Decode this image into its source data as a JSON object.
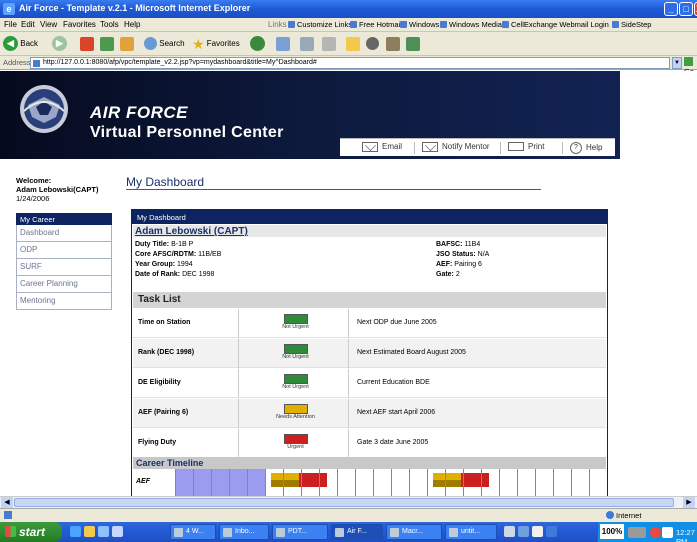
{
  "window": {
    "title": "Air Force - Template v.2.1 - Microsoft Internet Explorer",
    "min_glyph": "_",
    "max_glyph": "□",
    "close_glyph": "X"
  },
  "menu": {
    "items": [
      "File",
      "Edit",
      "View",
      "Favorites",
      "Tools",
      "Help"
    ],
    "links_label": "Links",
    "links": [
      "Customize Links",
      "Free Hotmail",
      "Windows",
      "Windows Media",
      "CellExchange Webmail Login",
      "SideStep"
    ]
  },
  "toolbar": {
    "back_label": "Back",
    "search_label": "Search",
    "favorites_label": "Favorites"
  },
  "address": {
    "label": "Address",
    "url": "http://127.0.0.1:8080/afp/vpc/template_v2.2.jsp?vp=mydashboard&title=My^Dashboard#",
    "go_label": "Go"
  },
  "banner": {
    "line1": "AIR FORCE",
    "line2": "Virtual Personnel Center"
  },
  "actions": {
    "email": "Email",
    "notify": "Notify Mentor",
    "print": "Print",
    "help": "Help"
  },
  "welcome": {
    "greeting": "Welcome:",
    "user": "Adam Lebowski(CAPT)",
    "date": "1/24/2006"
  },
  "page_title": "My Dashboard",
  "sidenav": {
    "header": "My Career",
    "items": [
      "Dashboard",
      "ODP",
      "SURF",
      "Career Planning",
      "Mentoring"
    ]
  },
  "dashboard": {
    "header": "My Dashboard",
    "name": "Adam Lebowski (CAPT)",
    "left_fields": [
      {
        "label": "Duty Title:",
        "value": "B-1B P"
      },
      {
        "label": "Core AFSC/RDTM:",
        "value": "11B/EB"
      },
      {
        "label": "Year Group:",
        "value": "1994"
      },
      {
        "label": "Date of Rank:",
        "value": "DEC 1998"
      }
    ],
    "right_fields": [
      {
        "label": "BAFSC:",
        "value": "11B4"
      },
      {
        "label": "JSO Status:",
        "value": "N/A"
      },
      {
        "label": "AEF:",
        "value": "Pairing 6"
      },
      {
        "label": "Gate:",
        "value": "2"
      }
    ],
    "task_list_title": "Task List",
    "tasks": [
      {
        "name": "Time on Station",
        "status": "Not Urgent",
        "color": "#2e8b3a",
        "message": "Next ODP due June 2005"
      },
      {
        "name": "Rank (DEC 1998)",
        "status": "Not Urgent",
        "color": "#2e8b3a",
        "message": "Next Estimated Board August 2005"
      },
      {
        "name": "DE Eligibility",
        "status": "Not Urgent",
        "color": "#2e8b3a",
        "message": "Current Education BDE"
      },
      {
        "name": "AEF (Pairing 6)",
        "status": "Needs Attention",
        "color": "#e0b000",
        "message": "Next AEF start April 2006"
      },
      {
        "name": "Flying Duty",
        "status": "Urgent",
        "color": "#cc1f1f",
        "message": "Gate 3 date June 2005"
      }
    ],
    "timeline_title": "Career Timeline",
    "timeline_row_label": "AEF"
  },
  "statusbar": {
    "zone": "Internet"
  },
  "taskbar": {
    "start": "start",
    "items": [
      "4 W...",
      "Inbo...",
      "PDT...",
      "Air F...",
      "Macr...",
      "untit..."
    ],
    "battery": "100%",
    "clock": "12:27 PM"
  },
  "colors": {
    "banner_bg": "#0d1a3d",
    "nav_blue": "#0e2461",
    "not_urgent": "#2e8b3a",
    "needs_attention": "#e0b000",
    "urgent": "#cc1f1f"
  }
}
